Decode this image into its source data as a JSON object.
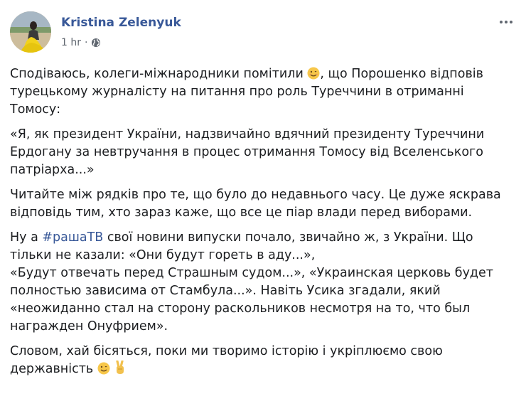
{
  "post": {
    "author": "Kristina Zelenyuk",
    "time": "1 hr",
    "separator": "·",
    "privacy_icon": "globe-icon",
    "more_icon": "ellipsis-icon",
    "avatar_icon": "profile-photo"
  },
  "paragraphs": {
    "p1_a": "Сподіваюсь, колеги-міжнародники помітили ",
    "p1_b": ", що Порошенко відповів турецькому журналісту на питання про роль Туреччини в отриманні Томосу:",
    "p2": "«Я, як президент України, надзвичайно вдячний президенту Туреччини Ердогану за невтручання в процес отримання Томосу від Вселенського патріарха...»",
    "p3": "Читайте між рядків про те, що було до недавнього часу. Це дуже яскрава відповідь тим, хто зараз каже, що все це піар влади перед виборами.",
    "p4_a": "Ну а ",
    "p4_hashtag": "#рашаТВ",
    "p4_b": " свої новини випуски почало, звичайно ж, з України. Що тільки не казали: «Они будут гореть в аду...»,",
    "p4_c": "«Будут отвечать перед Страшным судом...», «Украинская церковь будет полностью зависима от Стамбула...». Навіть Усика згадали, який «неожиданно стал на сторону раскольников несмотря на то, что был награжден Онуфрием».",
    "p5": "Словом, хай бісяться, поки ми творимо історію і укріплюємо свою державність "
  },
  "colors": {
    "link": "#385898",
    "text": "#1c1e21",
    "meta": "#606770",
    "emoji": "#f7c74a"
  }
}
